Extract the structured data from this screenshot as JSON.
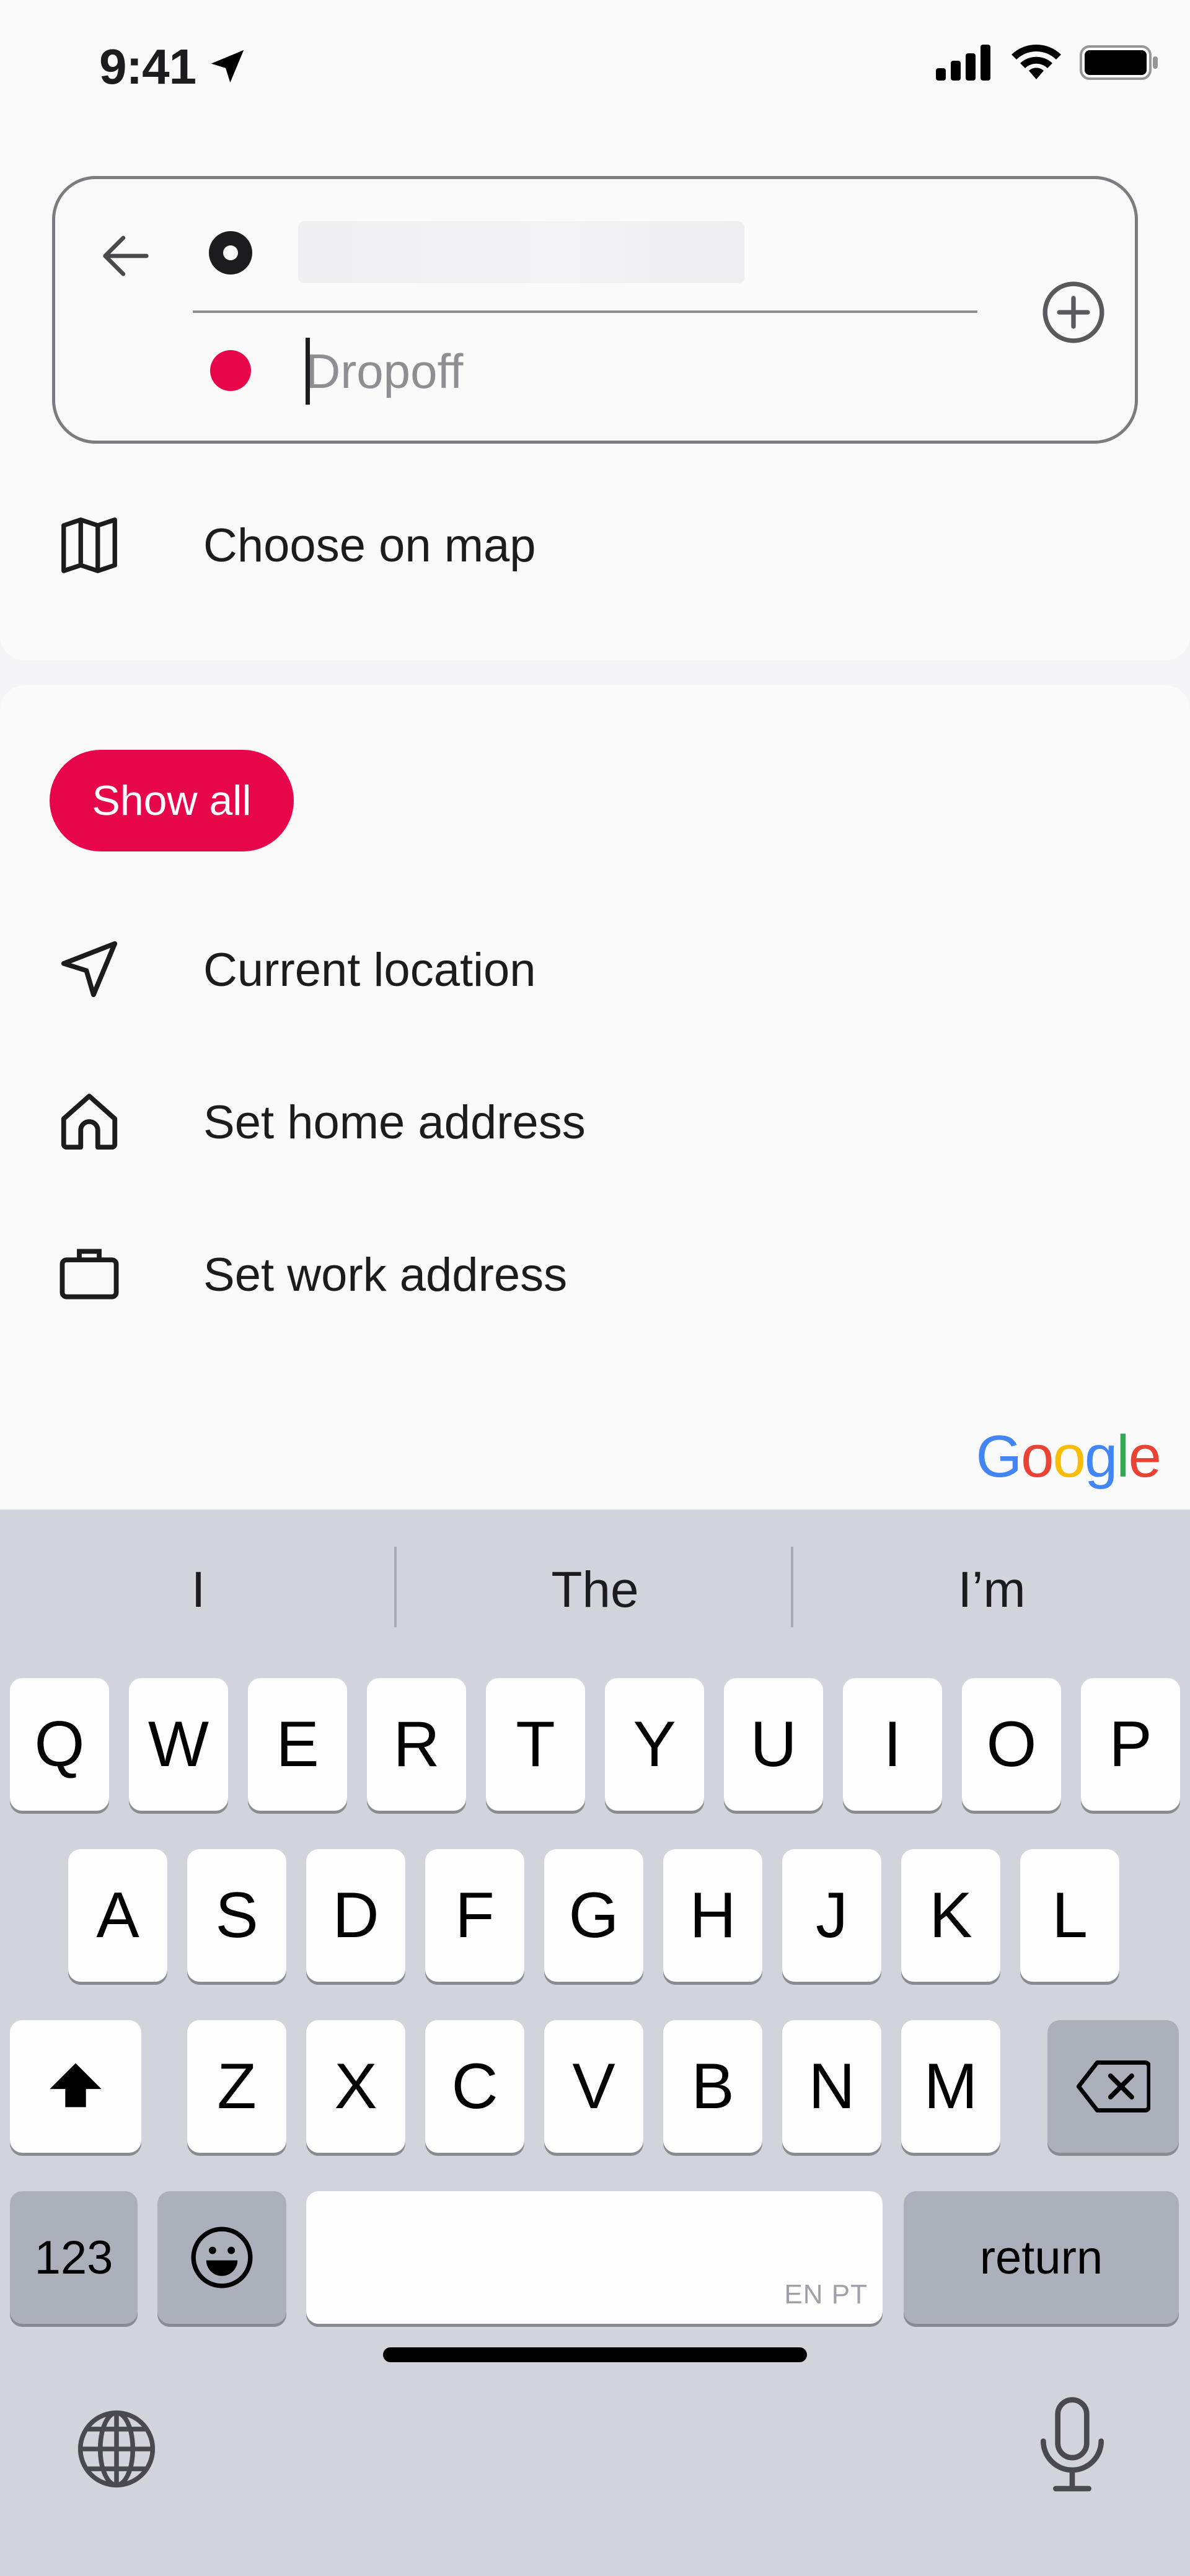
{
  "status_bar": {
    "time": "9:41"
  },
  "route": {
    "dropoff_placeholder": "Dropoff",
    "dropoff_value": ""
  },
  "choose_on_map": "Choose on map",
  "show_all_label": "Show all",
  "list": [
    {
      "label": "Current location",
      "icon": "navigation-arrow-icon"
    },
    {
      "label": "Set home address",
      "icon": "home-icon"
    },
    {
      "label": "Set work address",
      "icon": "briefcase-icon"
    }
  ],
  "google_logo": "Google",
  "colors": {
    "accent": "#e8064a",
    "keyboard_bg": "#d1d4db"
  },
  "keyboard": {
    "suggestions": [
      "I",
      "The",
      "I’m"
    ],
    "row1": [
      "Q",
      "W",
      "E",
      "R",
      "T",
      "Y",
      "U",
      "I",
      "O",
      "P"
    ],
    "row2": [
      "A",
      "S",
      "D",
      "F",
      "G",
      "H",
      "J",
      "K",
      "L"
    ],
    "row3": [
      "Z",
      "X",
      "C",
      "V",
      "B",
      "N",
      "M"
    ],
    "numbers_label": "123",
    "return_label": "return",
    "space_languages": "EN PT"
  }
}
